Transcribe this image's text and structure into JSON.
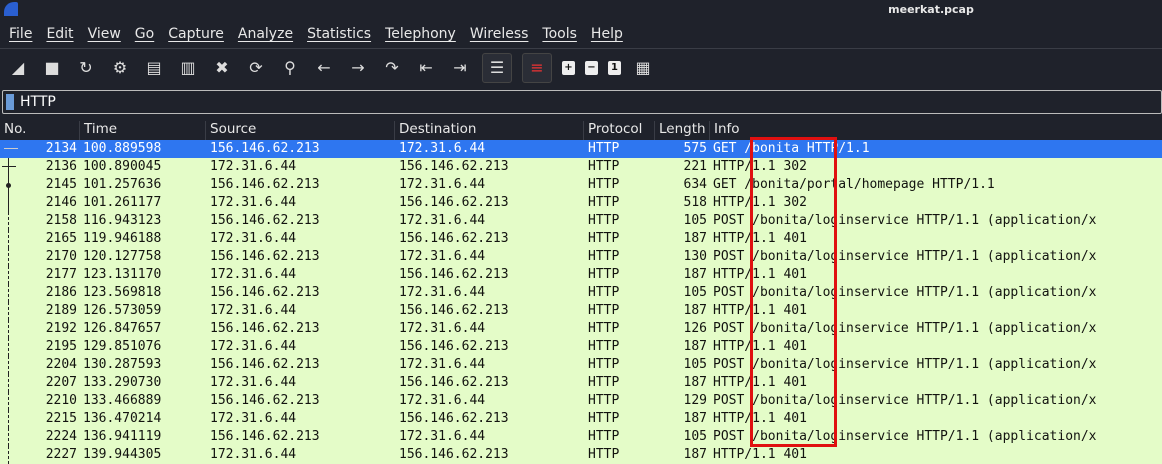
{
  "window": {
    "title": "meerkat.pcap"
  },
  "menu": [
    "File",
    "Edit",
    "View",
    "Go",
    "Capture",
    "Analyze",
    "Statistics",
    "Telephony",
    "Wireless",
    "Tools",
    "Help"
  ],
  "toolbar": [
    "start-capture-icon",
    "stop-capture-icon",
    "restart-capture-icon",
    "capture-options-icon",
    "open-file-icon",
    "save-file-icon",
    "close-file-icon",
    "reload-file-icon",
    "search-icon",
    "go-back-icon",
    "go-forward-icon",
    "go-to-packet-icon",
    "first-packet-icon",
    "last-packet-icon",
    "autoscroll-icon",
    "colorize-icon",
    "zoom-in-icon",
    "zoom-out-icon",
    "normal-size-icon",
    "resize-columns-icon"
  ],
  "filter": {
    "value": "HTTP"
  },
  "columns": [
    "No.",
    "Time",
    "Source",
    "Destination",
    "Protocol",
    "Length",
    "Info"
  ],
  "packets": [
    [
      "2134",
      "100.889598",
      "156.146.62.213",
      "172.31.6.44",
      "HTTP",
      "575",
      "GET /bonita HTTP/1.1"
    ],
    [
      "2136",
      "100.890045",
      "172.31.6.44",
      "156.146.62.213",
      "HTTP",
      "221",
      "HTTP/1.1 302"
    ],
    [
      "2145",
      "101.257636",
      "156.146.62.213",
      "172.31.6.44",
      "HTTP",
      "634",
      "GET /bonita/portal/homepage HTTP/1.1"
    ],
    [
      "2146",
      "101.261177",
      "172.31.6.44",
      "156.146.62.213",
      "HTTP",
      "518",
      "HTTP/1.1 302"
    ],
    [
      "2158",
      "116.943123",
      "156.146.62.213",
      "172.31.6.44",
      "HTTP",
      "105",
      "POST /bonita/loginservice HTTP/1.1  (application/x"
    ],
    [
      "2165",
      "119.946188",
      "172.31.6.44",
      "156.146.62.213",
      "HTTP",
      "187",
      "HTTP/1.1 401"
    ],
    [
      "2170",
      "120.127758",
      "156.146.62.213",
      "172.31.6.44",
      "HTTP",
      "130",
      "POST /bonita/loginservice HTTP/1.1  (application/x"
    ],
    [
      "2177",
      "123.131170",
      "172.31.6.44",
      "156.146.62.213",
      "HTTP",
      "187",
      "HTTP/1.1 401"
    ],
    [
      "2186",
      "123.569818",
      "156.146.62.213",
      "172.31.6.44",
      "HTTP",
      "105",
      "POST /bonita/loginservice HTTP/1.1  (application/x"
    ],
    [
      "2189",
      "126.573059",
      "172.31.6.44",
      "156.146.62.213",
      "HTTP",
      "187",
      "HTTP/1.1 401"
    ],
    [
      "2192",
      "126.847657",
      "156.146.62.213",
      "172.31.6.44",
      "HTTP",
      "126",
      "POST /bonita/loginservice HTTP/1.1  (application/x"
    ],
    [
      "2195",
      "129.851076",
      "172.31.6.44",
      "156.146.62.213",
      "HTTP",
      "187",
      "HTTP/1.1 401"
    ],
    [
      "2204",
      "130.287593",
      "156.146.62.213",
      "172.31.6.44",
      "HTTP",
      "105",
      "POST /bonita/loginservice HTTP/1.1  (application/x"
    ],
    [
      "2207",
      "133.290730",
      "172.31.6.44",
      "156.146.62.213",
      "HTTP",
      "187",
      "HTTP/1.1 401"
    ],
    [
      "2210",
      "133.466889",
      "156.146.62.213",
      "172.31.6.44",
      "HTTP",
      "129",
      "POST /bonita/loginservice HTTP/1.1  (application/x"
    ],
    [
      "2215",
      "136.470214",
      "172.31.6.44",
      "156.146.62.213",
      "HTTP",
      "187",
      "HTTP/1.1 401"
    ],
    [
      "2224",
      "136.941119",
      "156.146.62.213",
      "172.31.6.44",
      "HTTP",
      "105",
      "POST /bonita/loginservice HTTP/1.1  (application/x"
    ],
    [
      "2227",
      "139.944305",
      "172.31.6.44",
      "156.146.62.213",
      "HTTP",
      "187",
      "HTTP/1.1 401"
    ]
  ],
  "colors": {
    "selected": "#2e76f0",
    "http_row": "#e4fcc8",
    "highlight_box": "#e01010"
  }
}
